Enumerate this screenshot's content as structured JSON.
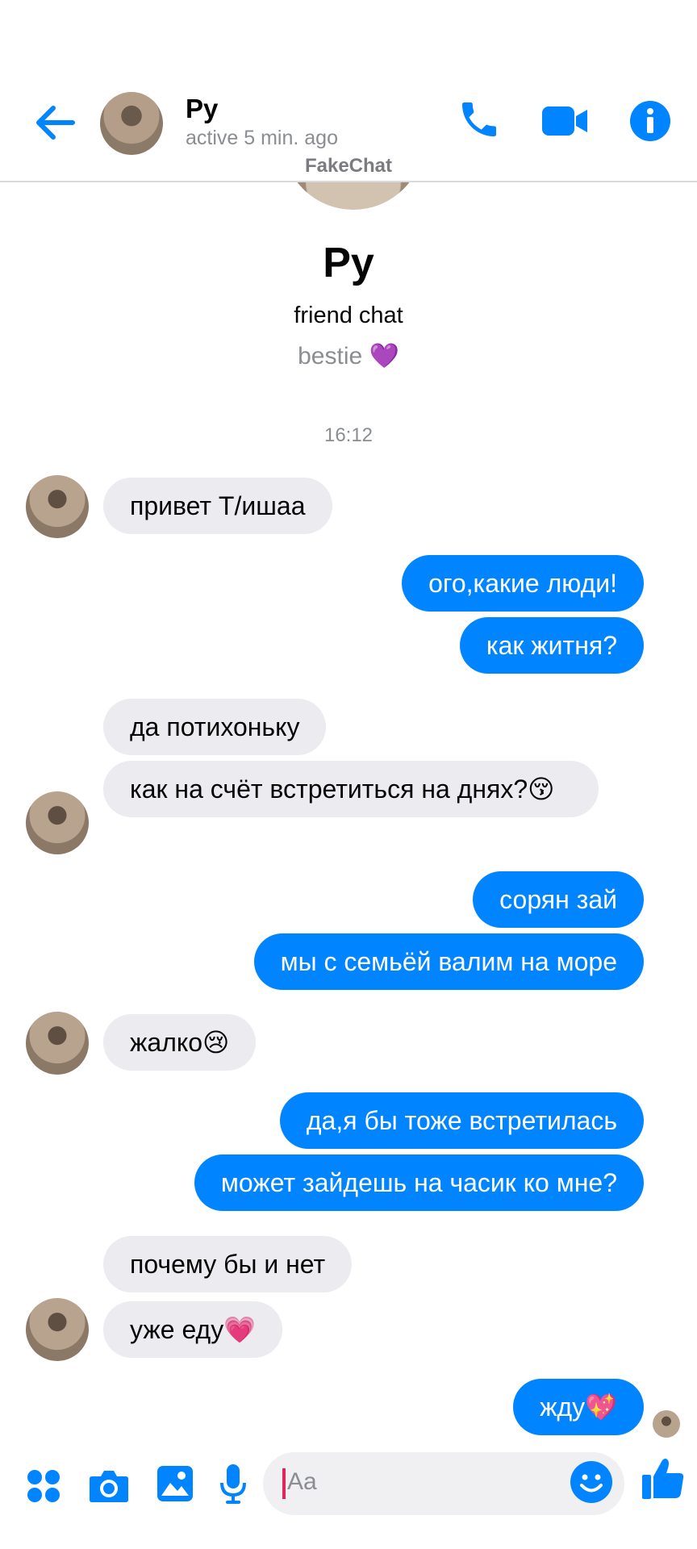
{
  "header": {
    "name": "Py",
    "status": "active 5 min. ago",
    "icons": [
      "back-arrow-icon",
      "phone-icon",
      "video-icon",
      "info-icon"
    ],
    "accent_color": "#0084ff"
  },
  "watermark": "FakeChat",
  "profile": {
    "name": "Py",
    "subtitle": "friend chat",
    "bio": "bestie 💜"
  },
  "timestamp": "16:12",
  "messages": [
    {
      "from": "them",
      "text": "привет Т/ишаа"
    },
    {
      "from": "me",
      "text": "ого,какие люди!"
    },
    {
      "from": "me",
      "text": "как житня?"
    },
    {
      "from": "them",
      "text": "да потихоньку"
    },
    {
      "from": "them",
      "text": "как на счёт встретиться на днях?😚"
    },
    {
      "from": "me",
      "text": "сорян зай"
    },
    {
      "from": "me",
      "text": "мы с семьёй валим на море"
    },
    {
      "from": "them",
      "text": "жалко😢"
    },
    {
      "from": "me",
      "text": "да,я бы тоже встретилась"
    },
    {
      "from": "me",
      "text": "может зайдешь на часик ко мне?"
    },
    {
      "from": "them",
      "text": "почему бы и нет"
    },
    {
      "from": "them",
      "text": "уже еду💗"
    },
    {
      "from": "me",
      "text": "жду💖"
    }
  ],
  "composer": {
    "placeholder": "Aa",
    "icons": [
      "apps-icon",
      "camera-icon",
      "gallery-icon",
      "microphone-icon",
      "emoji-icon",
      "like-thumb-icon"
    ]
  }
}
